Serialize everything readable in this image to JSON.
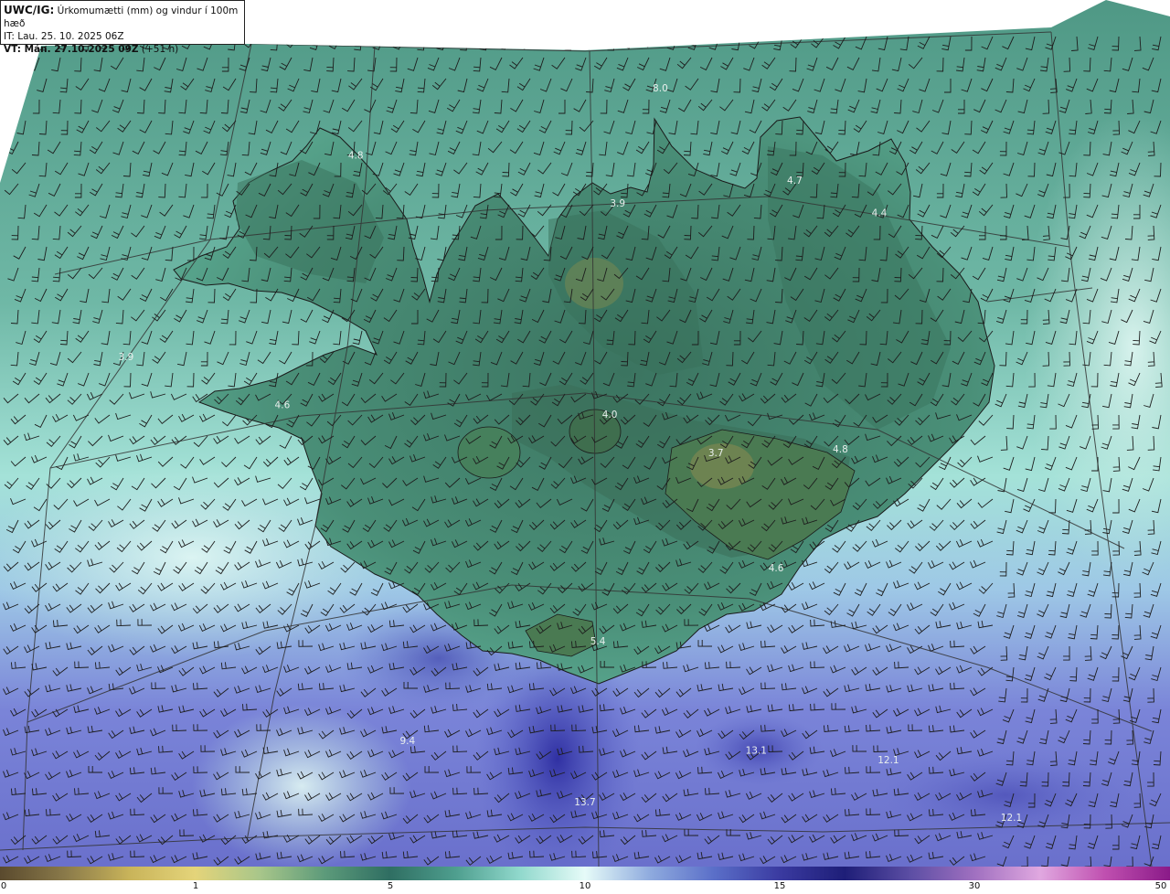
{
  "header": {
    "title_bold": "UWC/IG:",
    "title_rest": " Úrkomumætti (mm) og vindur í 100m hæð",
    "init_time": "IT: Lau. 25. 10. 2025 06Z",
    "valid_label": "VT: Mán. 27.10.2025 09Z",
    "valid_extra": " (+51 h)"
  },
  "max_labels": [
    {
      "text": "8.0",
      "lon": -17.6,
      "lat": 66.4
    },
    {
      "text": "4.8",
      "lon": -22.8,
      "lat": 66.05
    },
    {
      "text": "3.9",
      "lon": -18.35,
      "lat": 65.8
    },
    {
      "text": "4.7",
      "lon": -15.35,
      "lat": 65.92
    },
    {
      "text": "4.4",
      "lon": -13.95,
      "lat": 65.75
    },
    {
      "text": "3.9",
      "lon": -26.4,
      "lat": 65.0
    },
    {
      "text": "4.6",
      "lon": -23.8,
      "lat": 64.75
    },
    {
      "text": "4.0",
      "lon": -18.5,
      "lat": 64.7
    },
    {
      "text": "3.7",
      "lon": -16.8,
      "lat": 64.5
    },
    {
      "text": "4.8",
      "lon": -14.8,
      "lat": 64.52
    },
    {
      "text": "4.6",
      "lon": -15.9,
      "lat": 63.9
    },
    {
      "text": "5.4",
      "lon": -18.7,
      "lat": 63.52
    },
    {
      "text": "9.4",
      "lon": -21.6,
      "lat": 63.0
    },
    {
      "text": "13.7",
      "lon": -18.9,
      "lat": 62.68
    },
    {
      "text": "13.1",
      "lon": -16.3,
      "lat": 62.95
    },
    {
      "text": "12.1",
      "lon": -14.3,
      "lat": 62.9
    },
    {
      "text": "12.1",
      "lon": -12.5,
      "lat": 62.6
    }
  ],
  "colorbar": {
    "ticks": [
      "0",
      "1",
      "5",
      "10",
      "15",
      "30",
      "50"
    ],
    "colors": [
      "#5a4a2e",
      "#8a7a4a",
      "#c9b45a",
      "#e4d47a",
      "#a8c68a",
      "#5c9a7a",
      "#2f6e62",
      "#4e9e8e",
      "#90d8cc",
      "#e6fbf8",
      "#8eaade",
      "#5a6ec8",
      "#3a3aa0",
      "#1e1e78",
      "#5c4ea4",
      "#a070c0",
      "#e0a8e0",
      "#c050b0",
      "#8a1a88"
    ]
  },
  "colors": {
    "land_high": "#3e7a62",
    "land_low": "#4f9a84",
    "sea_north": "#4f9885",
    "sea_mid": "#9fe0d6",
    "sea_south": "#6f78d0",
    "sea_core": "#3434a8",
    "coast": "#1a1a1a",
    "grid": "#333333",
    "barb": "#1d1d1d"
  }
}
